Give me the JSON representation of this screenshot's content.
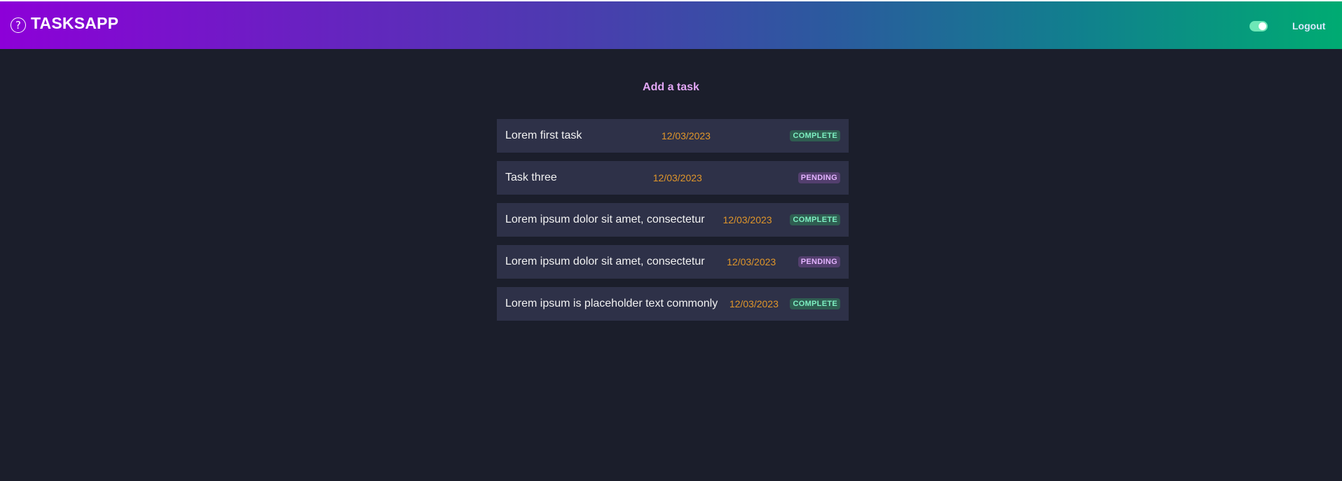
{
  "header": {
    "app_title": "TASKSAPP",
    "help_icon": "question-circle-icon",
    "help_glyph": "?",
    "toggle_state": "on",
    "logout_label": "Logout",
    "gradient_colors": [
      "#8d00d8",
      "#4c3bb0",
      "#117f8e",
      "#00ab72"
    ]
  },
  "main": {
    "add_task_label": "Add a task",
    "tasks": [
      {
        "title": "Lorem first task",
        "date": "12/03/2023",
        "status": "COMPLETE"
      },
      {
        "title": "Task three",
        "date": "12/03/2023",
        "status": "PENDING"
      },
      {
        "title": "Lorem ipsum dolor sit amet, consectetur",
        "date": "12/03/2023",
        "status": "COMPLETE"
      },
      {
        "title": "Lorem ipsum dolor sit amet, consectetur",
        "date": "12/03/2023",
        "status": "PENDING"
      },
      {
        "title": "Lorem ipsum is placeholder text commonly",
        "date": "12/03/2023",
        "status": "COMPLETE"
      }
    ]
  },
  "colors": {
    "background": "#1b1e2b",
    "card": "#2e3148",
    "date": "#e0962a",
    "complete_text": "#7df0c2",
    "pending_text": "#e3b3ff",
    "accent": "#e2a6f5"
  }
}
